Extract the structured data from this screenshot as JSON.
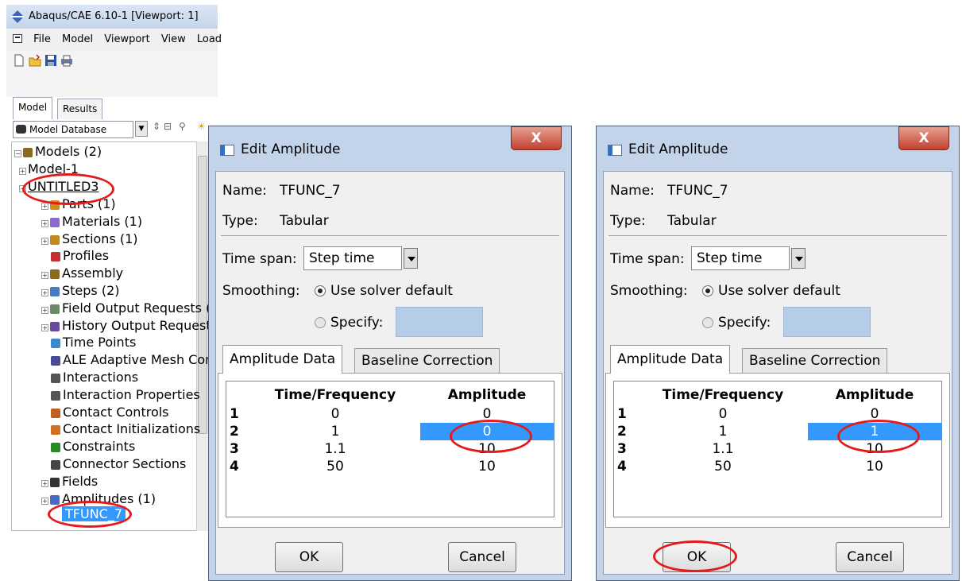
{
  "main_window": {
    "title": "Abaqus/CAE 6.10-1 [Viewport: 1]",
    "menu": [
      "File",
      "Model",
      "Viewport",
      "View",
      "Load"
    ],
    "tabs": [
      "Model",
      "Results"
    ],
    "database_selector": "Model Database",
    "tree": {
      "models_label": "Models (2)",
      "model1": "Model-1",
      "untitled": "UNTITLED3",
      "children": [
        {
          "label": "Parts (1)",
          "expand": true
        },
        {
          "label": "Materials (1)",
          "expand": true
        },
        {
          "label": "Sections (1)",
          "expand": true
        },
        {
          "label": "Profiles",
          "expand": false
        },
        {
          "label": "Assembly",
          "expand": true
        },
        {
          "label": "Steps (2)",
          "expand": true
        },
        {
          "label": "Field Output Requests (1)",
          "expand": true
        },
        {
          "label": "History Output Requests (1",
          "expand": true
        },
        {
          "label": "Time Points",
          "expand": false
        },
        {
          "label": "ALE Adaptive Mesh Constr",
          "expand": false
        },
        {
          "label": "Interactions",
          "expand": false
        },
        {
          "label": "Interaction Properties",
          "expand": false
        },
        {
          "label": "Contact Controls",
          "expand": false
        },
        {
          "label": "Contact Initializations",
          "expand": false
        },
        {
          "label": "Constraints",
          "expand": false
        },
        {
          "label": "Connector Sections",
          "expand": false
        },
        {
          "label": "Fields",
          "expand": true
        },
        {
          "label": "Amplitudes (1)",
          "expand": true
        }
      ],
      "selected_leaf": "TFUNC_7"
    }
  },
  "dialogs": [
    {
      "title": "Edit Amplitude",
      "close_glyph": "X",
      "name_label": "Name:",
      "name_value": "TFUNC_7",
      "type_label": "Type:",
      "type_value": "Tabular",
      "time_span_label": "Time span:",
      "time_span_value": "Step time",
      "smoothing_label": "Smoothing:",
      "smoothing_default": "Use solver default",
      "smoothing_specify": "Specify:",
      "tab_active": "Amplitude Data",
      "tab_inactive": "Baseline Correction",
      "table_headers": [
        "Time/Frequency",
        "Amplitude"
      ],
      "rows": [
        {
          "index": "1",
          "time": "0",
          "amp": "0"
        },
        {
          "index": "2",
          "time": "1",
          "amp": "0"
        },
        {
          "index": "3",
          "time": "1.1",
          "amp": "10"
        },
        {
          "index": "4",
          "time": "50",
          "amp": "10"
        }
      ],
      "ok_label": "OK",
      "cancel_label": "Cancel"
    },
    {
      "title": "Edit Amplitude",
      "close_glyph": "X",
      "name_label": "Name:",
      "name_value": "TFUNC_7",
      "type_label": "Type:",
      "type_value": "Tabular",
      "time_span_label": "Time span:",
      "time_span_value": "Step time",
      "smoothing_label": "Smoothing:",
      "smoothing_default": "Use solver default",
      "smoothing_specify": "Specify:",
      "tab_active": "Amplitude Data",
      "tab_inactive": "Baseline Correction",
      "table_headers": [
        "Time/Frequency",
        "Amplitude"
      ],
      "rows": [
        {
          "index": "1",
          "time": "0",
          "amp": "0"
        },
        {
          "index": "2",
          "time": "1",
          "amp": "1"
        },
        {
          "index": "3",
          "time": "1.1",
          "amp": "10"
        },
        {
          "index": "4",
          "time": "50",
          "amp": "10"
        }
      ],
      "ok_label": "OK",
      "cancel_label": "Cancel"
    }
  ],
  "colors": {
    "selection": "#3399ff",
    "annotation": "#e51b1b",
    "dialog_frame": "#c3d4ea",
    "close_button": "#c24030"
  }
}
